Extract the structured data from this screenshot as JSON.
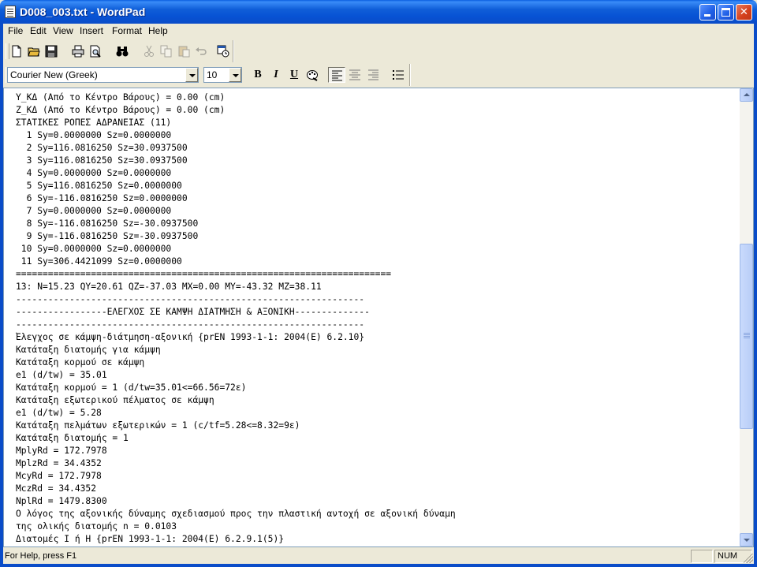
{
  "window": {
    "title": "D008_003.txt - WordPad",
    "app_icon": "wordpad-document-icon"
  },
  "menu": {
    "items": [
      "File",
      "Edit",
      "View",
      "Insert",
      "Format",
      "Help"
    ]
  },
  "toolbar": {
    "buttons": [
      {
        "name": "new-document-icon",
        "enabled": true
      },
      {
        "name": "open-folder-icon",
        "enabled": true
      },
      {
        "name": "save-disk-icon",
        "enabled": true
      },
      {
        "name": "print-icon",
        "enabled": true
      },
      {
        "name": "print-preview-icon",
        "enabled": true
      },
      {
        "name": "find-binoculars-icon",
        "enabled": true
      },
      {
        "name": "cut-scissors-icon",
        "enabled": false
      },
      {
        "name": "copy-icon",
        "enabled": false
      },
      {
        "name": "paste-icon",
        "enabled": false
      },
      {
        "name": "undo-icon",
        "enabled": false
      },
      {
        "name": "insert-date-time-icon",
        "enabled": true
      }
    ]
  },
  "format_bar": {
    "font_name": "Courier New (Greek)",
    "font_size": "10",
    "bold": "B",
    "italic": "I",
    "underline": "U",
    "active_alignment": "left",
    "colors": {
      "pressed_bg": "#f4f3ee"
    }
  },
  "document": {
    "lines": [
      "Y_ΚΔ (Από το Κέντρο Βάρους) = 0.00 (cm)",
      "Z_ΚΔ (Από το Κέντρο Βάρους) = 0.00 (cm)",
      "ΣΤΑΤΙΚΕΣ ΡΟΠΕΣ ΑΔΡΑΝΕΙΑΣ (11)",
      "  1 Sy=0.0000000 Sz=0.0000000",
      "  2 Sy=116.0816250 Sz=30.0937500",
      "  3 Sy=116.0816250 Sz=30.0937500",
      "  4 Sy=0.0000000 Sz=0.0000000",
      "  5 Sy=116.0816250 Sz=0.0000000",
      "  6 Sy=-116.0816250 Sz=0.0000000",
      "  7 Sy=0.0000000 Sz=0.0000000",
      "  8 Sy=-116.0816250 Sz=-30.0937500",
      "  9 Sy=-116.0816250 Sz=-30.0937500",
      " 10 Sy=0.0000000 Sz=0.0000000",
      " 11 Sy=306.4421099 Sz=0.0000000",
      "======================================================================",
      "13: N=15.23 QY=20.61 QZ=-37.03 MX=0.00 MY=-43.32 MZ=38.11",
      "-----------------------------------------------------------------",
      "-----------------ΕΛΕΓΧΟΣ ΣΕ ΚΑΜΨΗ ΔΙΑΤΜΗΣΗ & ΑΞΟΝΙΚΗ--------------",
      "-----------------------------------------------------------------",
      "Έλεγχος σε κάμψη-διάτμηση-αξονική {prEN 1993-1-1: 2004(E) 6.2.10}",
      "Κατάταξη διατομής για κάμψη",
      "Κατάταξη κορμού σε κάμψη",
      "e1 (d/tw) = 35.01",
      "Κατάταξη κορμού = 1 (d/tw=35.01<=66.56=72ε)",
      "Κατάταξη εξωτερικού πέλματος σε κάμψη",
      "e1 (d/tw) = 5.28",
      "Κατάταξη πελμάτων εξωτερικών = 1 (c/tf=5.28<=8.32=9ε)",
      "Κατάταξη διατομής = 1",
      "MplyRd = 172.7978",
      "MplzRd = 34.4352",
      "McyRd = 172.7978",
      "MczRd = 34.4352",
      "NplRd = 1479.8300",
      "Ο λόγος της αξονικής δύναμης σχεδιασμού προς την πλαστική αντοχή σε αξονική δύναμη",
      "της ολικής διατομής n = 0.0103",
      "Διατομές Ι ή Η {prEN 1993-1-1: 2004(E) 6.2.9.1(5)}"
    ]
  },
  "status": {
    "help_text": "For Help, press F1",
    "num_indicator": "NUM"
  }
}
